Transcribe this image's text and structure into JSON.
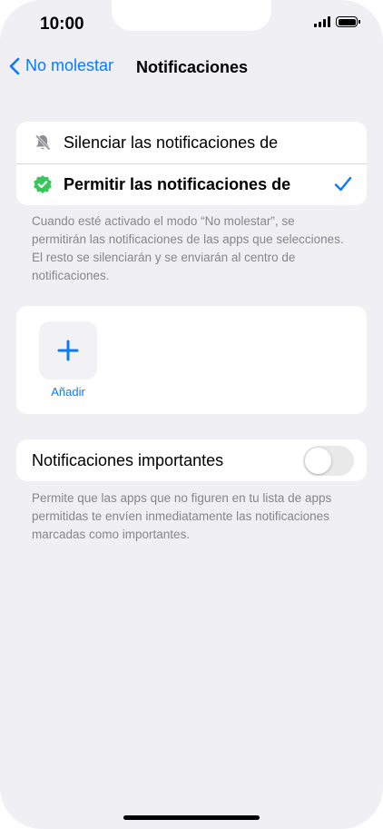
{
  "status_bar": {
    "time": "10:00"
  },
  "nav": {
    "back_label": "No molestar",
    "title": "Notificaciones"
  },
  "options": [
    {
      "label": "Silenciar las notificaciones de",
      "icon": "bell-slash-icon",
      "selected": false
    },
    {
      "label": "Permitir las notificaciones de",
      "icon": "verified-badge-icon",
      "selected": true
    }
  ],
  "options_footnote": "Cuando esté activado el modo “No molestar”, se permitirán las notificaciones de las apps que selecciones. El resto se silenciarán y se enviarán al centro de notificaciones.",
  "apps": {
    "add_label": "Añadir"
  },
  "important": {
    "label": "Notificaciones importantes",
    "enabled": false,
    "footnote": "Permite que las apps que no figuren en tu lista de apps permitidas te envíen inmediatamente las notificaciones marcadas como importantes."
  },
  "colors": {
    "accent": "#0a7aff",
    "badge_green": "#34c759",
    "background": "#efeff4"
  }
}
